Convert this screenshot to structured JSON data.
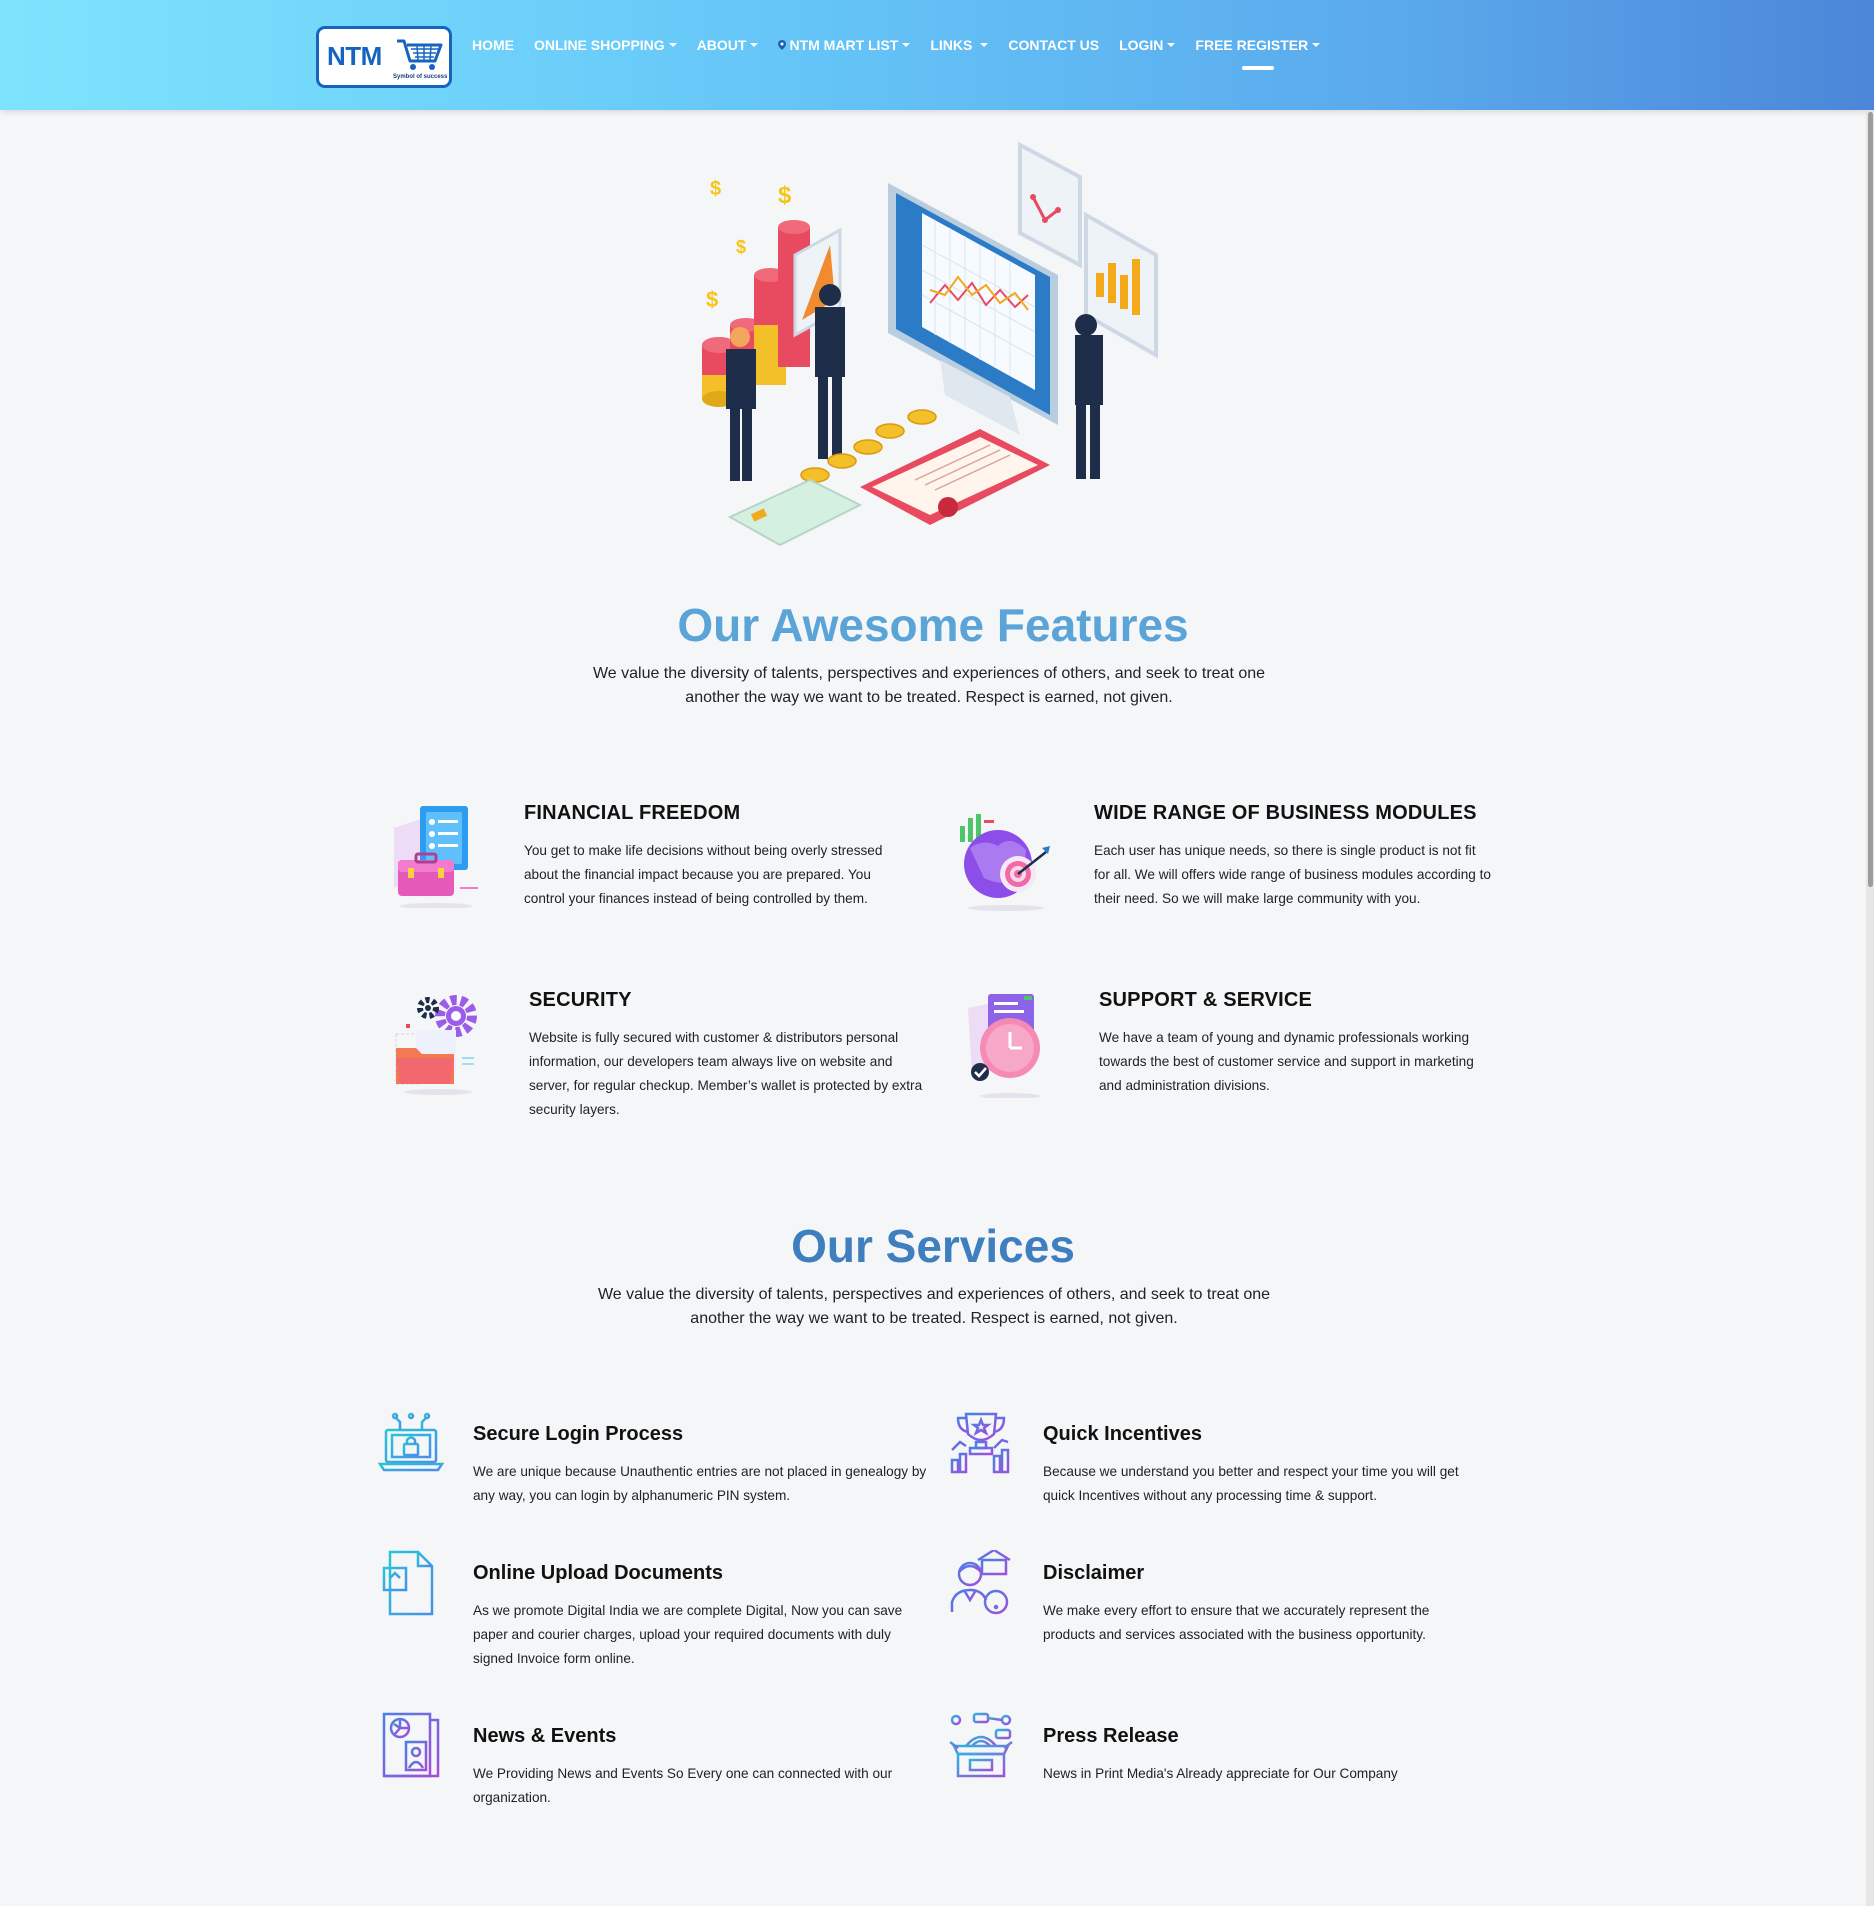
{
  "header": {
    "logo_text": "NTM",
    "logo_tagline": "Symbol of success",
    "nav": [
      {
        "label": "HOME",
        "dropdown": false
      },
      {
        "label": "ONLINE SHOPPING",
        "dropdown": true
      },
      {
        "label": "ABOUT",
        "dropdown": true
      },
      {
        "label": "NTM MART LIST",
        "dropdown": true
      },
      {
        "label": "LINKS",
        "dropdown": true
      },
      {
        "label": "CONTACT US",
        "dropdown": false
      },
      {
        "label": "LOGIN",
        "dropdown": true
      },
      {
        "label": "FREE REGISTER",
        "dropdown": true
      }
    ]
  },
  "colors": {
    "features_title": "#5aa4d8",
    "services_title": "#3f7fbf",
    "header_gradient_start": "#7ee4fd",
    "header_gradient_end": "#4c86d8"
  },
  "features": {
    "title": "Our Awesome Features",
    "subtitle_line1": "We value the diversity of talents, perspectives and experiences of others, and seek to treat one",
    "subtitle_line2": "another the way we want to be treated. Respect is earned, not given.",
    "items": [
      {
        "title": "FINANCIAL FREEDOM",
        "icon": "briefcase-document-icon",
        "text": "You get to make life decisions without being overly stressed about the financial impact because you are prepared. You  control your finances instead of being controlled by them."
      },
      {
        "title": "WIDE RANGE OF BUSINESS MODULES",
        "icon": "target-chart-icon",
        "text": "Each user has unique needs, so there is single product is not fit for all. We will offers wide range of business modules  according to their need. So we will make large community with  you."
      },
      {
        "title": "SECURITY",
        "icon": "gears-folder-icon",
        "text": "Website is fully secured with customer & distributors personal information, our developers team always live on website and server, for regular checkup. Member’s wallet is protected by extra security layers."
      },
      {
        "title": "SUPPORT & SERVICE",
        "icon": "clock-document-icon",
        "text": "We have a team of young and dynamic professionals working towards the best of customer service and support in marketing and administration divisions."
      }
    ]
  },
  "services": {
    "title": "Our Services",
    "subtitle_line1": "We value the diversity of talents, perspectives and experiences of others, and seek to treat one",
    "subtitle_line2": "another the way we want to be treated. Respect is earned, not given.",
    "items": [
      {
        "title": "Secure Login Process",
        "icon": "laptop-lock-icon",
        "text": "We are unique because Unauthentic entries are not placed in genealogy by any way, you can login by alphanumeric PIN system."
      },
      {
        "title": "Quick Incentives",
        "icon": "trophy-chart-icon",
        "text": "Because we understand you better and respect your time you will get quick Incentives without any processing time & support."
      },
      {
        "title": "Online Upload Documents",
        "icon": "document-upload-icon",
        "text": "As we promote Digital India we are complete Digital, Now you can save paper and courier charges, upload your required documents with duly signed Invoice form online."
      },
      {
        "title": "Disclaimer",
        "icon": "person-warning-icon",
        "text": "We make every effort to ensure that we accurately represent the products and services associated with the business opportunity."
      },
      {
        "title": "News & Events",
        "icon": "newspaper-icon",
        "text": "We Providing News and Events So Every one can connected with our organization."
      },
      {
        "title": "Press Release",
        "icon": "press-box-icon",
        "text": "News in Print Media's Already appreciate for Our Company"
      }
    ]
  }
}
